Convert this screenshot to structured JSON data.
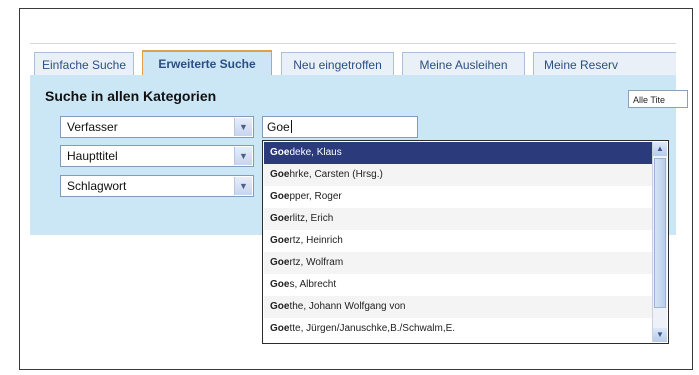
{
  "tabs": [
    {
      "label": "Einfache Suche",
      "active": false
    },
    {
      "label": "Erweiterte Suche",
      "active": true
    },
    {
      "label": "Neu eingetroffen",
      "active": false
    },
    {
      "label": "Meine Ausleihen",
      "active": false
    },
    {
      "label": "Meine Reserv",
      "active": false
    }
  ],
  "panel": {
    "title": "Suche in allen Kategorien",
    "alle_button": "Alle Tite"
  },
  "fields": [
    {
      "label": "Verfasser"
    },
    {
      "label": "Haupttitel"
    },
    {
      "label": "Schlagwort"
    }
  ],
  "search": {
    "value": "Goe"
  },
  "suggestions": [
    {
      "prefix": "Goe",
      "rest": "deke, Klaus",
      "selected": true
    },
    {
      "prefix": "Goe",
      "rest": "hrke, Carsten (Hrsg.)",
      "selected": false
    },
    {
      "prefix": "Goe",
      "rest": "pper, Roger",
      "selected": false
    },
    {
      "prefix": "Goe",
      "rest": "rlitz, Erich",
      "selected": false
    },
    {
      "prefix": "Goe",
      "rest": "rtz, Heinrich",
      "selected": false
    },
    {
      "prefix": "Goe",
      "rest": "rtz, Wolfram",
      "selected": false
    },
    {
      "prefix": "Goe",
      "rest": "s, Albrecht",
      "selected": false
    },
    {
      "prefix": "Goe",
      "rest": "the, Johann Wolfgang von",
      "selected": false
    },
    {
      "prefix": "Goe",
      "rest": "tte, Jürgen/Januschke,B./Schwalm,E.",
      "selected": false
    }
  ],
  "colors": {
    "panel_bg": "#cbe7f6",
    "active_tab_border": "#e0a04a",
    "selected_row": "#2a3a7a"
  }
}
